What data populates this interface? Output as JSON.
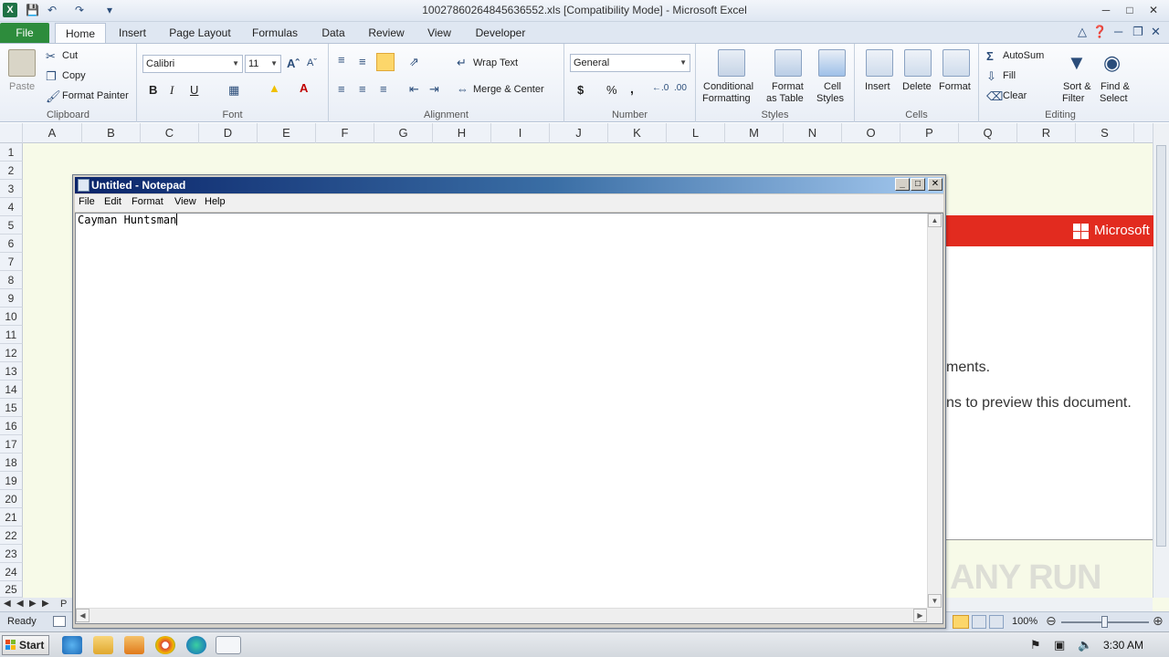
{
  "excel": {
    "title": "10027860264845636552.xls  [Compatibility Mode] - Microsoft Excel",
    "logo": "X",
    "tabs": [
      {
        "label": "File"
      },
      {
        "label": "Home"
      },
      {
        "label": "Insert"
      },
      {
        "label": "Page Layout"
      },
      {
        "label": "Formulas"
      },
      {
        "label": "Data"
      },
      {
        "label": "Review"
      },
      {
        "label": "View"
      },
      {
        "label": "Developer"
      }
    ],
    "ribbon": {
      "clipboard": {
        "label": "Clipboard",
        "paste": "Paste",
        "cut": "Cut",
        "copy": "Copy",
        "format_painter": "Format Painter"
      },
      "font": {
        "label": "Font",
        "name": "Calibri",
        "size": "11",
        "bold": "B",
        "italic": "I",
        "underline": "U"
      },
      "alignment": {
        "label": "Alignment",
        "wrap_text": "Wrap Text",
        "merge_center": "Merge & Center"
      },
      "number": {
        "label": "Number",
        "format": "General",
        "currency": "$",
        "percent": "%",
        "comma": ","
      },
      "styles": {
        "label": "Styles",
        "conditional_1": "Conditional",
        "conditional_2": "Formatting",
        "format_table_1": "Format",
        "format_table_2": "as Table",
        "cell_styles_1": "Cell",
        "cell_styles_2": "Styles"
      },
      "cells": {
        "label": "Cells",
        "insert": "Insert",
        "delete": "Delete",
        "format": "Format"
      },
      "editing": {
        "label": "Editing",
        "autosum": "AutoSum",
        "fill": "Fill",
        "clear": "Clear",
        "sort_1": "Sort &",
        "sort_2": "Filter",
        "find_1": "Find &",
        "find_2": "Select"
      }
    },
    "columns": [
      "A",
      "B",
      "C",
      "D",
      "E",
      "F",
      "G",
      "H",
      "I",
      "J",
      "K",
      "L",
      "M",
      "N",
      "O",
      "P",
      "Q",
      "R",
      "S"
    ],
    "rows": [
      "1",
      "2",
      "3",
      "4",
      "5",
      "6",
      "7",
      "8",
      "9",
      "10",
      "11",
      "12",
      "13",
      "14",
      "15",
      "16",
      "17",
      "18",
      "19",
      "20",
      "21",
      "22",
      "23",
      "24",
      "25"
    ],
    "document": {
      "brand": "Microsoft",
      "line1": "ments.",
      "line2": "ns to preview this document."
    },
    "status": {
      "ready": "Ready",
      "zoom": "100%"
    },
    "sheet_tab_partial": "P"
  },
  "notepad": {
    "title": "Untitled - Notepad",
    "menu": [
      "File",
      "Edit",
      "Format",
      "View",
      "Help"
    ],
    "content": "Cayman Huntsman"
  },
  "taskbar": {
    "start": "Start",
    "clock": "3:30 AM"
  },
  "watermark": "ANY RUN"
}
